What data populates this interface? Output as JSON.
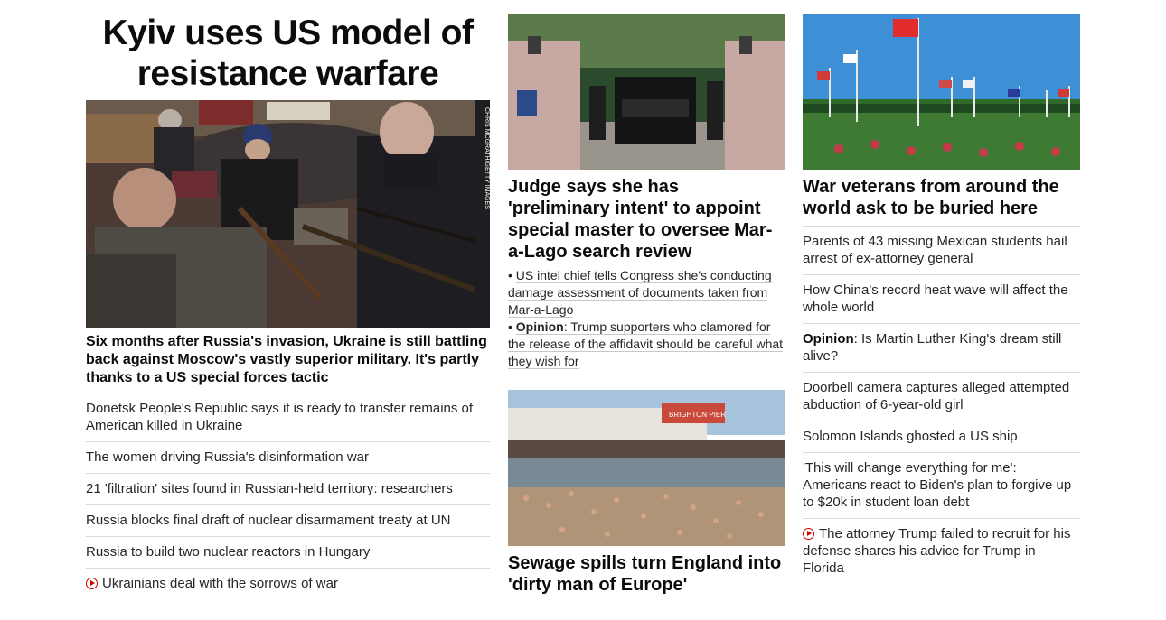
{
  "left": {
    "headline": "Kyiv uses US model of resistance warfare",
    "photo_credit": "CHRIS MCGRATH/GETTY IMAGES",
    "lead_caption": "Six months after Russia's invasion, Ukraine is still battling back against Moscow's vastly superior military. It's partly thanks to a US special forces tactic",
    "stories": [
      {
        "text": "Donetsk People's Republic says it is ready to transfer remains of American killed in Ukraine"
      },
      {
        "text": "The women driving Russia's disinformation war"
      },
      {
        "text": "21 'filtration' sites found in Russian-held territory: researchers"
      },
      {
        "text": "Russia blocks final draft of nuclear disarmament treaty at UN"
      },
      {
        "text": "Russia to build two nuclear reactors in Hungary"
      },
      {
        "text": "Ukrainians deal with the sorrows of war",
        "video": true
      }
    ]
  },
  "middle": {
    "story1_headline": "Judge says she has 'preliminary intent' to appoint special master to oversee Mar-a-Lago search review",
    "bullets": [
      {
        "prefix": "• ",
        "label": "",
        "text": "US intel chief tells Congress she's conducting damage assessment of documents taken from Mar-a-Lago"
      },
      {
        "prefix": "• ",
        "label": "Opinion",
        "text": ": Trump supporters who clamored for the release of the affidavit should be careful what they wish for"
      }
    ],
    "pier_sign": "BRIGHTON PIER",
    "story2_headline": "Sewage spills turn England into 'dirty man of Europe'"
  },
  "right": {
    "story_headline": "War veterans from around the world ask to be buried here",
    "stories": [
      {
        "label": "",
        "text": "Parents of 43 missing Mexican students hail arrest of ex-attorney general"
      },
      {
        "label": "",
        "text": "How China's record heat wave will affect the whole world"
      },
      {
        "label": "Opinion",
        "text": ": Is Martin Luther King's dream still alive?"
      },
      {
        "label": "",
        "text": "Doorbell camera captures alleged attempted abduction of 6-year-old girl"
      },
      {
        "label": "",
        "text": "Solomon Islands ghosted a US ship"
      },
      {
        "label": "",
        "text": "'This will change everything for me': Americans react to Biden's plan to forgive up to $20k in student loan debt"
      },
      {
        "label": "",
        "text": "The attorney Trump failed to recruit for his defense shares his advice for Trump in Florida",
        "video": true
      }
    ]
  },
  "colors": {
    "video_red": "#cc0000",
    "divider": "#d9d9d9",
    "text": "#0c0c0c"
  }
}
